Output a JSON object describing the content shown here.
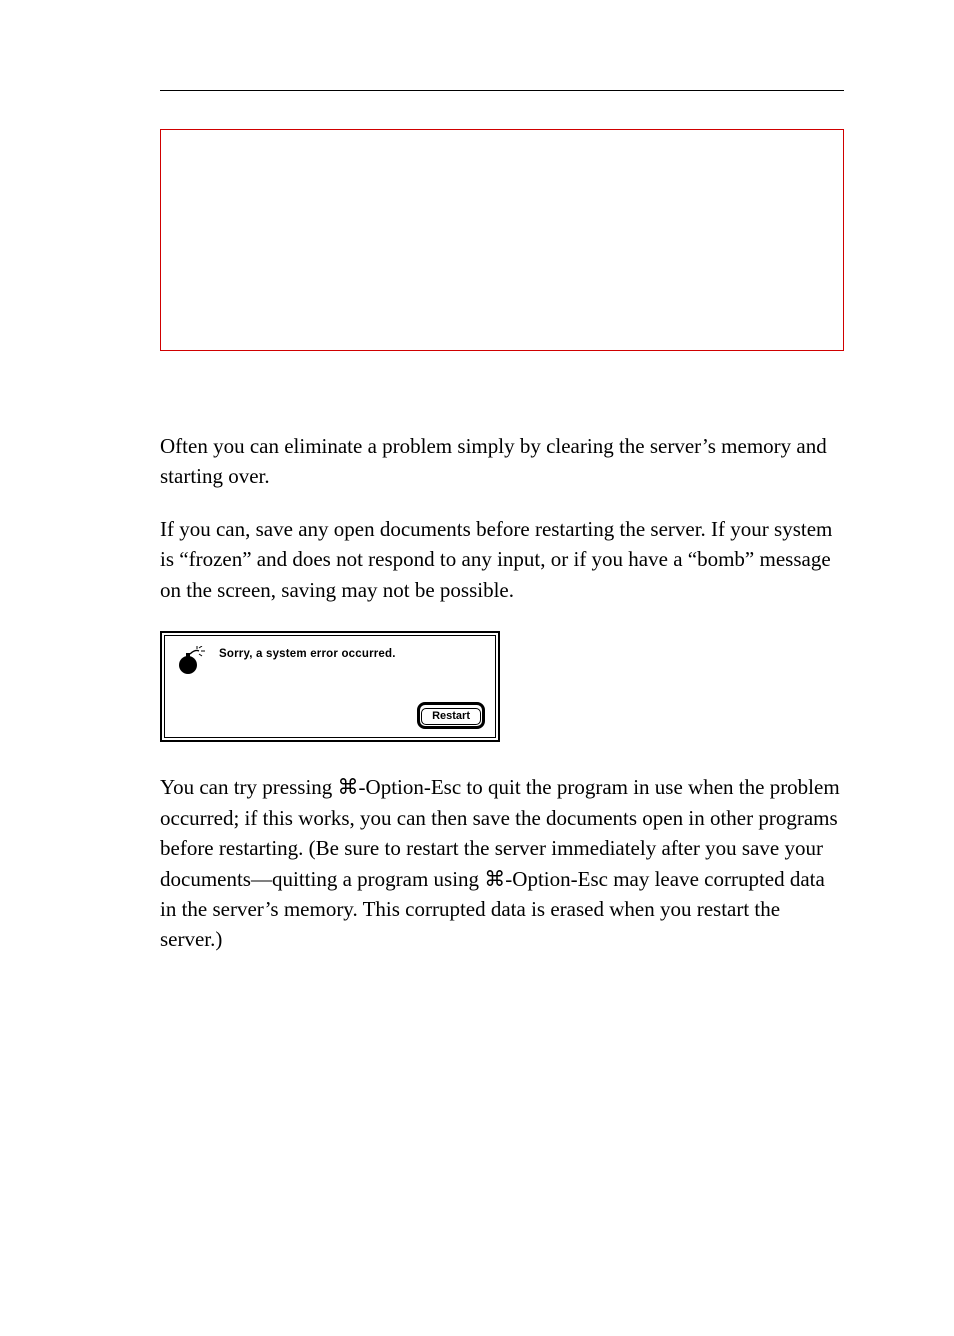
{
  "paragraphs": {
    "p1": "Often you can eliminate a problem simply by clearing the server’s memory and starting over.",
    "p2": "If you can, save any open documents before restarting the server. If your system is “frozen” and does not respond to any input, or if you have a “bomb” message on the screen, saving may not be possible.",
    "p3_a": "You can try pressing ",
    "p3_b": "-Option-Esc to quit the program in use when the problem occurred; if this works, you can then save the documents open in other programs before restarting. (Be sure to restart the server immediately after you save your documents—quitting a program using ",
    "p3_c": "-Option-Esc may leave corrupted data in the server’s memory. This corrupted data is erased when you restart the server.)",
    "cmd_symbol": "⌘"
  },
  "dialog": {
    "message": "Sorry, a system error occurred.",
    "button": "Restart"
  }
}
